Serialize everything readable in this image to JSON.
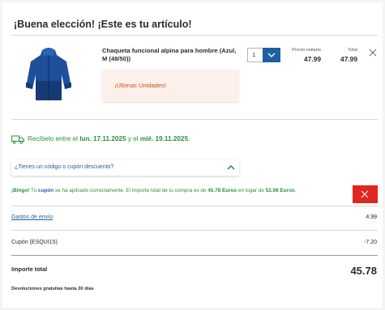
{
  "header": {
    "title": "¡Buena elección! ¡Este es tu artículo!"
  },
  "product": {
    "name": "Chaqueta funcional alpina para hombre (Azul, M (48/50))",
    "stock_notice": "¡Últimas Unidades!",
    "quantity": "1",
    "unit_price_label": "Precio unitario",
    "unit_price": "47.99",
    "total_label": "Total",
    "total": "47.99",
    "image_icon": "blue-jacket-image"
  },
  "delivery": {
    "prefix": "Recíbelo entre el ",
    "date_from": "lun. 17.11.2025",
    "middle": " y el ",
    "date_to": "mié. 19.11.2025",
    "suffix": "."
  },
  "coupon": {
    "toggle_label": "¿Tienes un código o cupón descuento?"
  },
  "bingo": {
    "bingo": "¡Bingo!",
    "part1": " Tu ",
    "cupon": "cupón",
    "part2": " se ha aplicado correctamente. El importe total de tu compra es de ",
    "amount_new": "45.78 Euros",
    "part3": " en lugar de ",
    "amount_old": "52.98 Euros",
    "part4": "."
  },
  "summary": {
    "shipping_label": "Gastos de envío",
    "shipping_value": "4.99",
    "coupon_label": "Cupón (ESQUI15)",
    "coupon_value": "-7.20",
    "total_label": "Importe total",
    "total_value": "45.78",
    "returns": "Devoluciones gratuitas hasta 30 días"
  },
  "colors": {
    "accent_blue": "#1f5fa0",
    "success_green": "#2c8f3a",
    "danger_red": "#e2251d",
    "warning_orange": "#d04b1e"
  }
}
